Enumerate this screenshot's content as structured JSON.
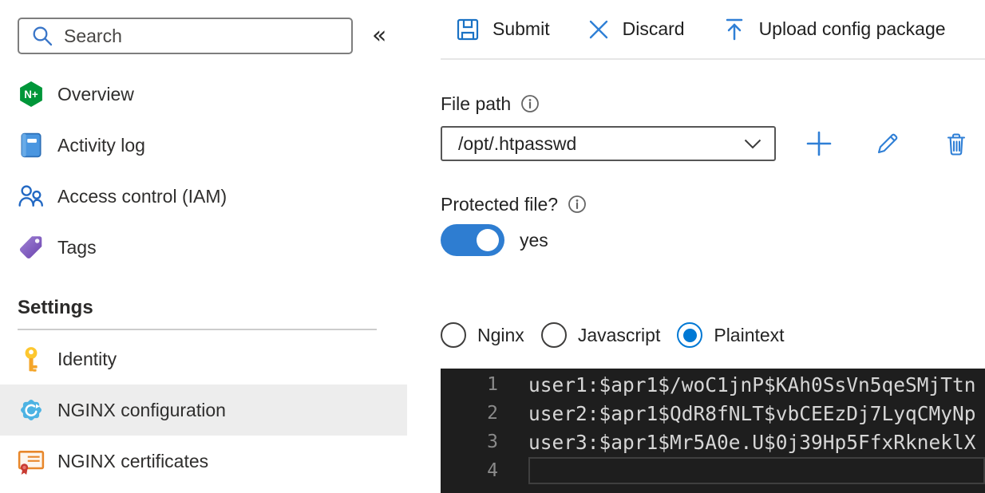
{
  "colors": {
    "accent": "#0078d4",
    "toggle_on": "#2e7dd1",
    "nginx_green": "#009639",
    "selected_row_bg": "#ededed",
    "editor_bg": "#1e1e1e",
    "editor_text": "#d6d6d6",
    "editor_line_number": "#8a8a8a",
    "editor_current_line_border": "#3f3f3f"
  },
  "sidebar": {
    "search": {
      "placeholder": "Search"
    },
    "collapse_glyph": "«",
    "items": [
      {
        "label": "Overview",
        "icon": "nginx-logo",
        "icon_text": "N+"
      },
      {
        "label": "Activity log",
        "icon": "activity-log"
      },
      {
        "label": "Access control (IAM)",
        "icon": "access-control"
      },
      {
        "label": "Tags",
        "icon": "tag"
      }
    ],
    "settings_section": {
      "header": "Settings",
      "items": [
        {
          "label": "Identity",
          "icon": "key",
          "selected": false
        },
        {
          "label": "NGINX configuration",
          "icon": "gear",
          "selected": true
        },
        {
          "label": "NGINX certificates",
          "icon": "certificate",
          "selected": false
        }
      ]
    }
  },
  "toolbar": {
    "submit_label": "Submit",
    "discard_label": "Discard",
    "upload_label": "Upload config package"
  },
  "file_path": {
    "label": "File path",
    "value": "/opt/.htpasswd"
  },
  "protected_file": {
    "label": "Protected file?",
    "value_label": "yes",
    "on": true
  },
  "syntax_options": [
    {
      "label": "Nginx",
      "selected": false
    },
    {
      "label": "Javascript",
      "selected": false
    },
    {
      "label": "Plaintext",
      "selected": true
    }
  ],
  "editor": {
    "lines": [
      {
        "number": "1",
        "text": "user1:$apr1$/woC1jnP$KAh0SsVn5qeSMjTtn",
        "current": false
      },
      {
        "number": "2",
        "text": "user2:$apr1$QdR8fNLT$vbCEEzDj7LyqCMyNp",
        "current": false
      },
      {
        "number": "3",
        "text": "user3:$apr1$Mr5A0e.U$0j39Hp5FfxRkneklX",
        "current": false
      },
      {
        "number": "4",
        "text": "",
        "current": true
      }
    ]
  }
}
